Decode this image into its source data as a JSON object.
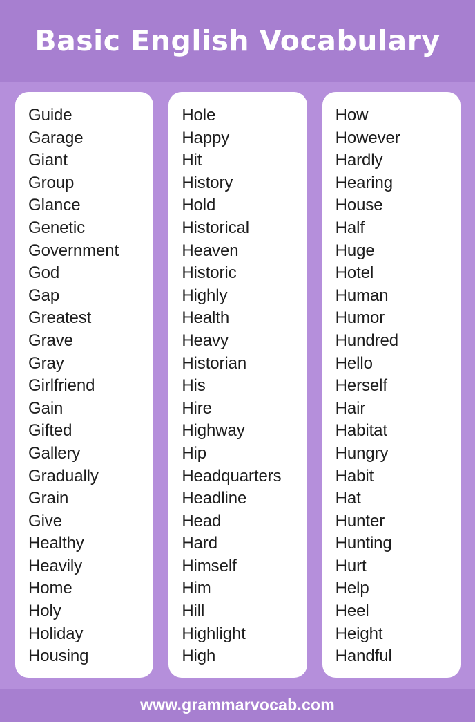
{
  "header": {
    "title": "Basic English Vocabulary",
    "band_color": "#a77fd0",
    "title_color": "#ffffff"
  },
  "page": {
    "background_color": "#b58fdb",
    "card_color": "#ffffff",
    "word_color": "#1d1d1d"
  },
  "columns": [
    {
      "name": "column-1",
      "words": [
        "Guide",
        "Garage",
        "Giant",
        "Group",
        "Glance",
        "Genetic",
        "Government",
        "God",
        "Gap",
        "Greatest",
        "Grave",
        "Gray",
        "Girlfriend",
        "Gain",
        "Gifted",
        "Gallery",
        "Gradually",
        "Grain",
        "Give",
        "Healthy",
        "Heavily",
        "Home",
        "Holy",
        "Holiday",
        "Housing"
      ]
    },
    {
      "name": "column-2",
      "words": [
        "Hole",
        "Happy",
        "Hit",
        "History",
        "Hold",
        "Historical",
        "Heaven",
        "Historic",
        "Highly",
        "Health",
        "Heavy",
        "Historian",
        "His",
        "Hire",
        "Highway",
        "Hip",
        "Headquarters",
        "Headline",
        "Head",
        "Hard",
        "Himself",
        "Him",
        "Hill",
        "Highlight",
        "High"
      ]
    },
    {
      "name": "column-3",
      "words": [
        "How",
        "However",
        "Hardly",
        "Hearing",
        "House",
        "Half",
        "Huge",
        "Hotel",
        "Human",
        "Humor",
        "Hundred",
        "Hello",
        "Herself",
        "Hair",
        "Habitat",
        "Hungry",
        "Habit",
        "Hat",
        "Hunter",
        "Hunting",
        "Hurt",
        "Help",
        "Heel",
        "Height",
        "Handful"
      ]
    }
  ],
  "footer": {
    "url": "www.grammarvocab.com",
    "band_color": "#a77fd0",
    "text_color": "#ffffff"
  }
}
